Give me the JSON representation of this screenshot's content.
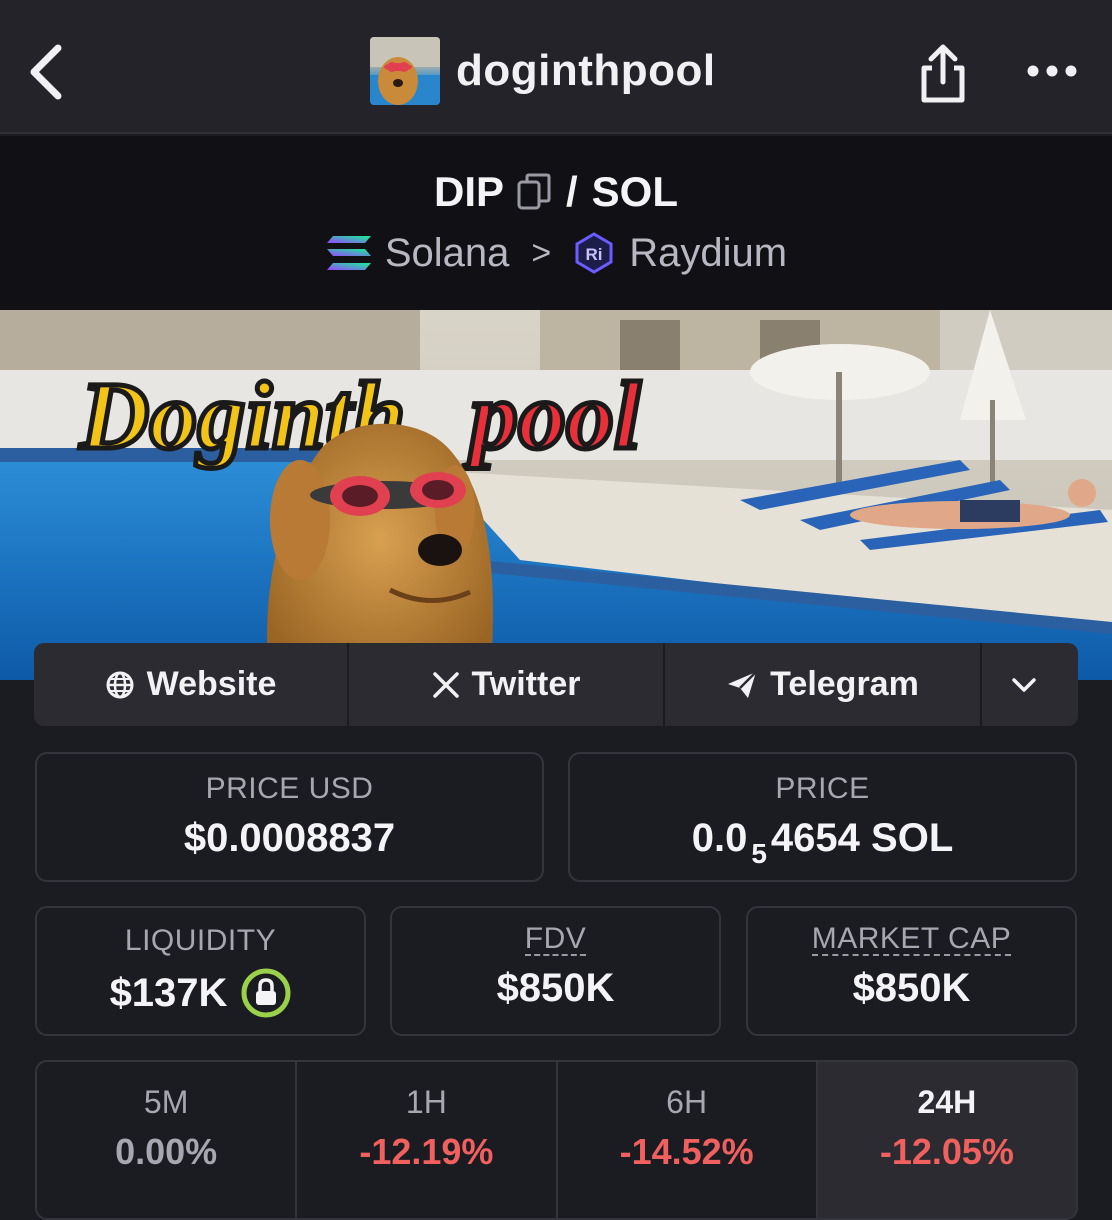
{
  "nav": {
    "title": "doginthpool",
    "back_icon": "chevron-left-icon",
    "share_icon": "share-icon",
    "more_icon": "more-horizontal-icon"
  },
  "pair": {
    "base": "DIP",
    "slash": "/",
    "quote": "SOL",
    "chain": "Solana",
    "separator": ">",
    "dex": "Raydium"
  },
  "banner": {
    "logo_part1": "Doginth",
    "logo_part2": "pool"
  },
  "links": [
    {
      "label": "Website",
      "icon": "globe-icon"
    },
    {
      "label": "Twitter",
      "icon": "x-logo-icon"
    },
    {
      "label": "Telegram",
      "icon": "telegram-icon"
    }
  ],
  "stats": {
    "price_usd_label": "PRICE USD",
    "price_usd": "$0.0008837",
    "price_label": "PRICE",
    "price_native_prefix": "0.0",
    "price_native_zeros": "5",
    "price_native_rest": "4654 SOL",
    "liquidity_label": "LIQUIDITY",
    "liquidity": "$137K",
    "fdv_label": "FDV",
    "fdv": "$850K",
    "mcap_label": "MARKET CAP",
    "mcap": "$850K"
  },
  "timeframes": [
    {
      "label": "5M",
      "value": "0.00%",
      "tone": "neutral"
    },
    {
      "label": "1H",
      "value": "-12.19%",
      "tone": "negative"
    },
    {
      "label": "6H",
      "value": "-14.52%",
      "tone": "negative"
    },
    {
      "label": "24H",
      "value": "-12.05%",
      "tone": "negative",
      "active": true
    }
  ],
  "colors": {
    "negative": "#f0605e",
    "lock_green": "#9ad04a",
    "background": "#1b1b22"
  }
}
